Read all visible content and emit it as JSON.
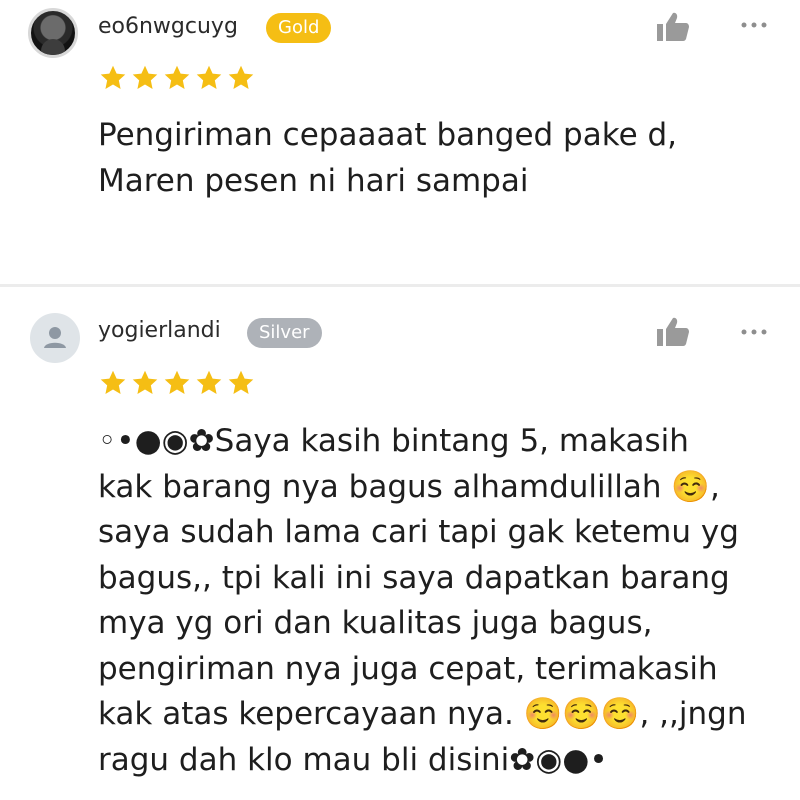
{
  "reviews": [
    {
      "username": "eo6nwgcuyg",
      "badge": "Gold",
      "badge_color": "#f5be14",
      "rating": 5,
      "text": "Pengiriman cepaaaat banged pake d,\nMaren pesen ni hari sampai",
      "avatar_icon": "user-photo-icon"
    },
    {
      "username": "yogierlandi",
      "badge": "Silver",
      "badge_color": "#aeb2b8",
      "rating": 5,
      "text": "◦•●◉✿Saya  kasih bintang 5, makasih\nkak barang nya bagus alhamdulillah ☺️,\nsaya sudah lama cari tapi gak ketemu yg\nbagus,, tpi kali ini saya dapatkan barang\nmya yg ori dan kualitas juga bagus,\npengiriman nya juga cepat, terimakasih\nkak atas kepercayaan nya. ☺️☺️☺️, ,,jngn\nragu dah klo mau bli disini✿◉●•",
      "avatar_icon": "default-user-icon"
    }
  ],
  "colors": {
    "star": "#f5be14",
    "icon_gray": "#9a9a9a"
  }
}
